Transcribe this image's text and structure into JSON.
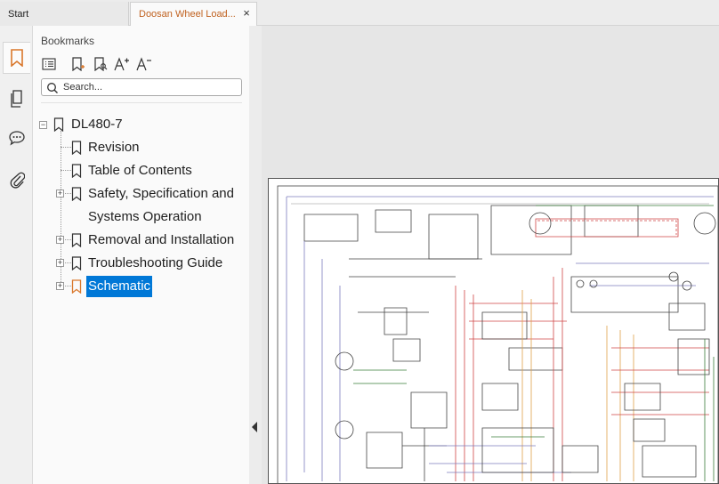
{
  "tabs": [
    {
      "label": "Start"
    },
    {
      "label": "Doosan Wheel Load...",
      "close": "×"
    }
  ],
  "panel": {
    "title": "Bookmarks",
    "search_placeholder": "Search..."
  },
  "tree": [
    {
      "label": "DL480-7"
    },
    {
      "label": "Revision"
    },
    {
      "label": "Table of Contents"
    },
    {
      "label": "Safety, Specification and"
    },
    {
      "label": "Systems Operation"
    },
    {
      "label": "Removal and Installation"
    },
    {
      "label": "Troubleshooting Guide"
    },
    {
      "label": "Schematic"
    }
  ],
  "colors": {
    "accent": "#c0611f",
    "selection": "#0078d7",
    "bookmark_orange": "#d9772b"
  },
  "icons": {
    "rail": [
      "bookmark-icon",
      "pages-icon",
      "comment-icon",
      "attachment-icon"
    ],
    "toolbar": [
      "outline-view-icon",
      "add-bookmark-icon",
      "bookmark-search-icon",
      "increase-font-icon",
      "decrease-font-icon"
    ]
  }
}
